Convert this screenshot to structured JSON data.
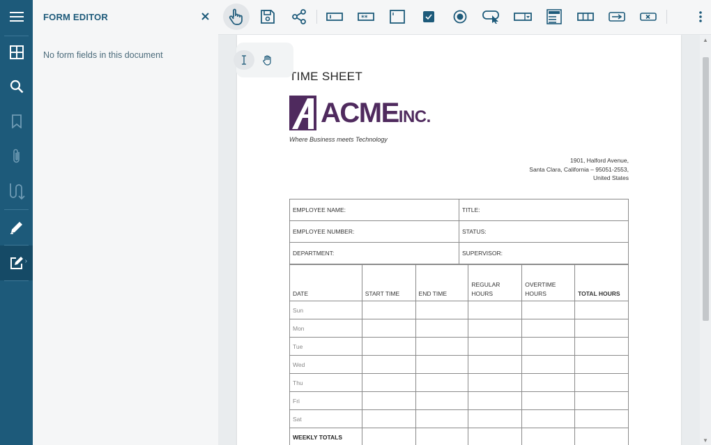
{
  "panel": {
    "title": "FORM EDITOR",
    "empty_message": "No form fields in this document"
  },
  "rail_icons": [
    "menu-icon",
    "thumbnails-icon",
    "search-icon",
    "bookmark-icon",
    "attachment-icon",
    "signature-icon",
    "annotation-pen-icon",
    "form-editor-icon"
  ],
  "toolbar_icons": [
    "pointer-hand-icon",
    "save-icon",
    "share-icon",
    "textbox-field-icon",
    "password-field-icon",
    "multiline-field-icon",
    "checkbox-field-icon",
    "radio-field-icon",
    "button-field-icon",
    "dropdown-field-icon",
    "listbox-field-icon",
    "combobox-field-icon",
    "tab-order-icon",
    "delete-field-icon",
    "more-icon"
  ],
  "document": {
    "title": "TIME SHEET",
    "logo_name": "ACME",
    "logo_suffix": "INC.",
    "tagline": "Where Business meets Technology",
    "address_line1": "1901, Halford Avenue,",
    "address_line2": "Santa Clara, California – 95051-2553,",
    "address_line3": "United States",
    "info_fields": [
      [
        "EMPLOYEE NAME:",
        "TITLE:"
      ],
      [
        "EMPLOYEE NUMBER:",
        "STATUS:"
      ],
      [
        "DEPARTMENT:",
        "SUPERVISOR:"
      ]
    ],
    "columns": [
      "DATE",
      "START TIME",
      "END TIME",
      "REGULAR HOURS",
      "OVERTIME HOURS",
      "TOTAL HOURS"
    ],
    "days": [
      "Sun",
      "Mon",
      "Tue",
      "Wed",
      "Thu",
      "Fri",
      "Sat"
    ],
    "totals_label": "WEEKLY TOTALS"
  },
  "colors": {
    "rail": "#1d5a7a",
    "accent": "#1d5a7a",
    "logo": "#4f2a5e"
  }
}
